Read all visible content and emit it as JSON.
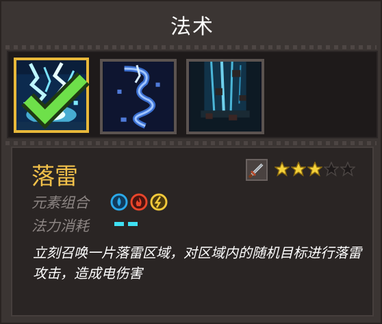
{
  "panel": {
    "title": "法术"
  },
  "skills": [
    {
      "name": "lightning-burst",
      "selected": true,
      "checked": true
    },
    {
      "name": "lightning-tornado",
      "selected": false
    },
    {
      "name": "falling-rocks",
      "selected": false
    }
  ],
  "detail": {
    "name": "落雷",
    "weapon_icon": "sword-icon",
    "stars_filled": 3,
    "stars_total": 5,
    "elements_label": "元素组合",
    "elements": [
      "water",
      "fire",
      "lightning"
    ],
    "mana_label": "法力消耗",
    "mana_cost": 2,
    "description": "立刻召唤一片落雷区域，对区域内的随机目标进行落雷攻击，造成电伤害"
  },
  "colors": {
    "accent_gold": "#f2c14a",
    "mana": "#3fe0f2",
    "water": "#2aa8e8",
    "fire": "#e8452a",
    "lightning": "#f2c93a"
  }
}
